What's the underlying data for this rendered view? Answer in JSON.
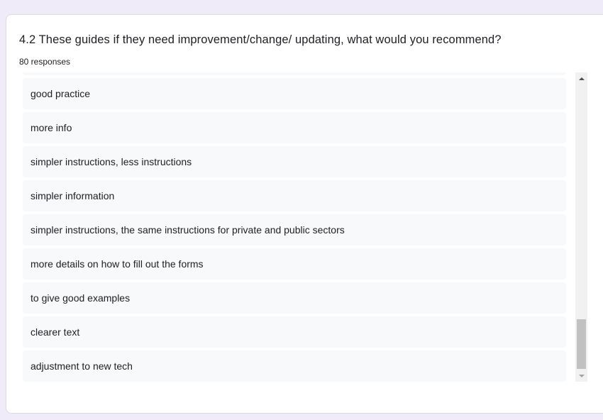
{
  "question": {
    "title": "4.2 These guides if they need improvement/change/ updating, what would you recommend?",
    "response_count": "80 responses"
  },
  "responses": [
    "good practice",
    "more info",
    "simpler instructions, less instructions",
    "simpler information",
    "simpler instructions, the same instructions for private and public sectors",
    "more details on how to fill out the forms",
    "to give good examples",
    "clearer text",
    "adjustment to new tech"
  ],
  "icons": {
    "scroll_up": "triangle-up-icon",
    "scroll_down": "triangle-down-icon"
  },
  "colors": {
    "page_background": "#f0ebf8",
    "card_background": "#ffffff",
    "response_background": "#f8f9fa",
    "text": "#202124",
    "scroll_thumb": "#c1c1c1"
  }
}
